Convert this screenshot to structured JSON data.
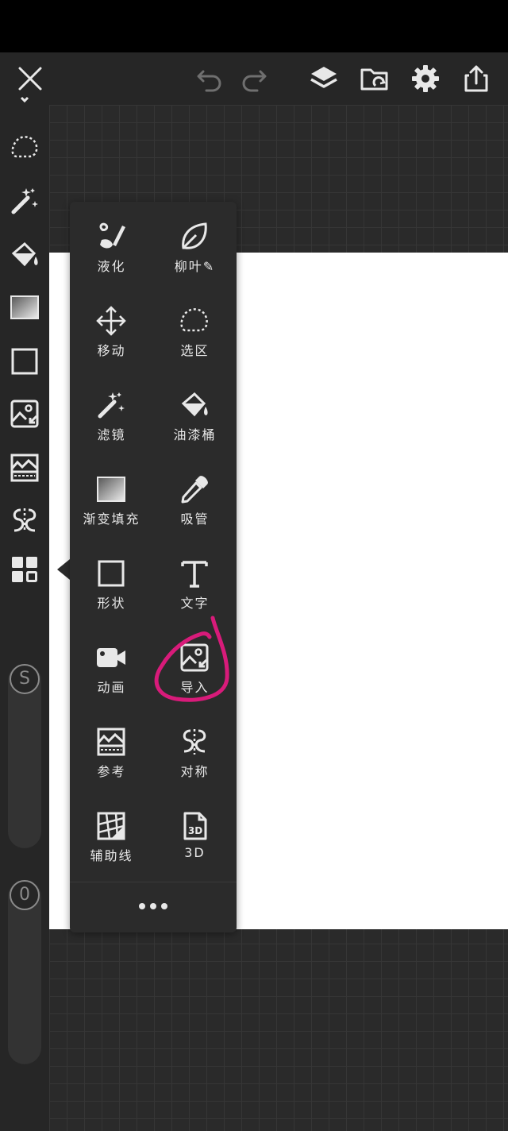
{
  "colors": {
    "toolbar_bg": "#262626",
    "canvas_bg": "#2a2a2a",
    "panel_bg": "#2b2b2b",
    "text": "#e8e8e8",
    "annotation": "#d81b7a"
  },
  "toolbar": {
    "icons": [
      "close-icon",
      "undo-icon",
      "redo-icon",
      "layers-icon",
      "folder-icon",
      "settings-icon",
      "share-icon"
    ]
  },
  "sliders": {
    "size_label": "S",
    "opacity_label": "0"
  },
  "tool_menu": {
    "items": [
      {
        "label": "液化",
        "icon": "liquify-icon"
      },
      {
        "label": "柳叶✎",
        "icon": "leaf-icon"
      },
      {
        "label": "移动",
        "icon": "move-icon"
      },
      {
        "label": "选区",
        "icon": "lasso-icon"
      },
      {
        "label": "滤镜",
        "icon": "magic-wand-icon"
      },
      {
        "label": "油漆桶",
        "icon": "paint-bucket-icon"
      },
      {
        "label": "渐变填充",
        "icon": "gradient-icon"
      },
      {
        "label": "吸管",
        "icon": "eyedropper-icon"
      },
      {
        "label": "形状",
        "icon": "shape-icon"
      },
      {
        "label": "文字",
        "icon": "text-icon"
      },
      {
        "label": "动画",
        "icon": "video-icon"
      },
      {
        "label": "导入",
        "icon": "import-image-icon"
      },
      {
        "label": "参考",
        "icon": "reference-icon"
      },
      {
        "label": "对称",
        "icon": "symmetry-icon"
      },
      {
        "label": "辅助线",
        "icon": "guides-icon"
      },
      {
        "label": "3D",
        "icon": "3d-icon"
      }
    ],
    "more_icon": "more-icon"
  }
}
